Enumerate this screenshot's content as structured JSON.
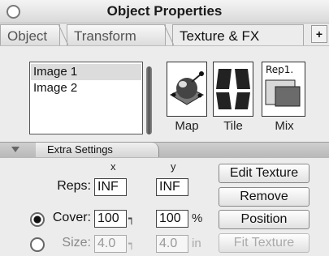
{
  "window": {
    "title": "Object Properties"
  },
  "tabs": [
    {
      "label": "Object",
      "active": false
    },
    {
      "label": "Transform",
      "active": false
    },
    {
      "label": "Texture & FX",
      "active": true
    }
  ],
  "tab_corner_icon": "plus-icon",
  "image_list": {
    "items": [
      "Image 1",
      "Image 2"
    ],
    "selected_index": 0
  },
  "modes": [
    {
      "label": "Map",
      "icon": "map-sphere-icon",
      "selected": true
    },
    {
      "label": "Tile",
      "icon": "tile-grid-icon",
      "selected": false
    },
    {
      "label": "Mix",
      "icon": "mix-icon",
      "selected": false,
      "badge": "Rep1."
    }
  ],
  "extra_settings": {
    "label": "Extra Settings"
  },
  "settings": {
    "col_x": "x",
    "col_y": "y",
    "reps": {
      "label": "Reps:",
      "x": "INF",
      "y": "INF"
    },
    "cover": {
      "label": "Cover:",
      "x": "100",
      "y": "100",
      "unit": "%",
      "selected": true
    },
    "size": {
      "label": "Size:",
      "x": "4.0",
      "y": "4.0",
      "unit": "in",
      "selected": false
    }
  },
  "actions": {
    "edit_texture": "Edit Texture",
    "remove": "Remove",
    "position": "Position",
    "fit_texture": "Fit Texture"
  },
  "colors": {
    "panel_bg": "#ececec",
    "selection": "#dcdcdc",
    "disabled_text": "#aaaaaa"
  }
}
